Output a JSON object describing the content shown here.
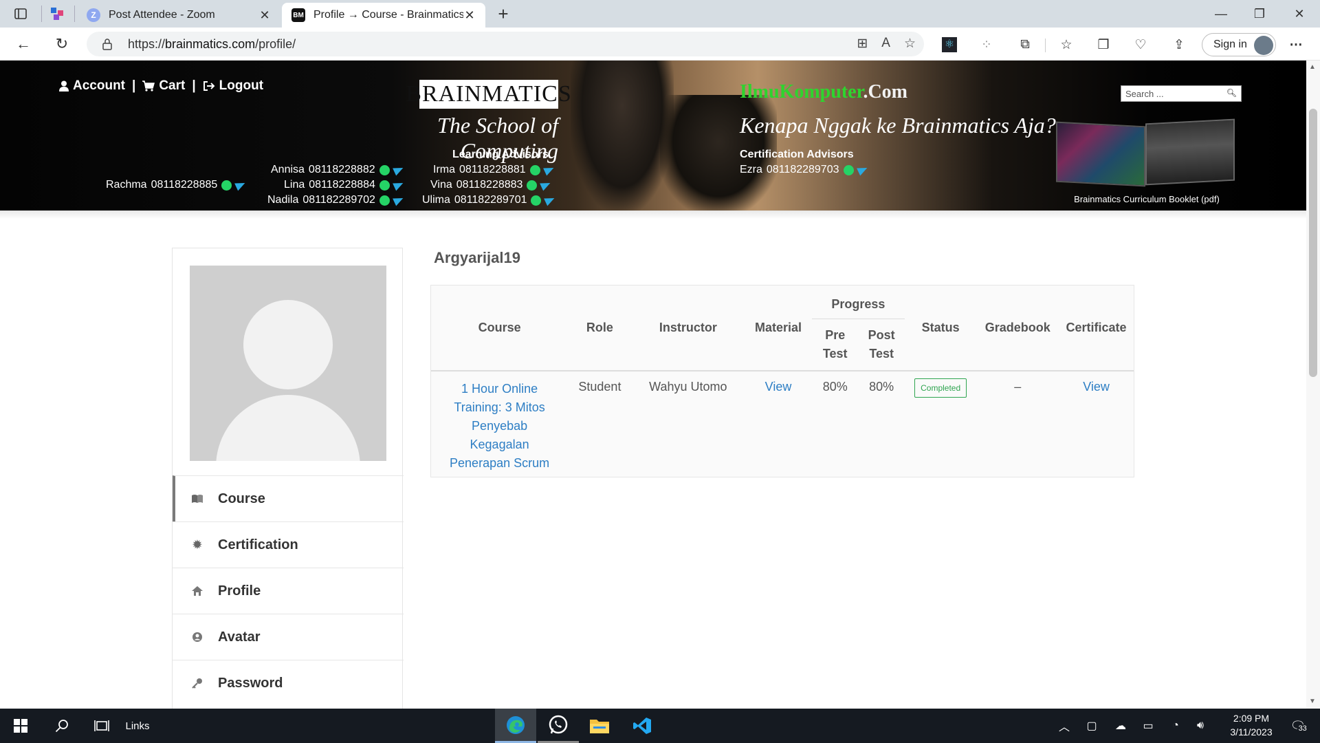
{
  "browser": {
    "tabs": [
      {
        "title": "Post Attendee - Zoom",
        "favicon": "Z",
        "active": false
      },
      {
        "title": "Profile → Course - Brainmatics",
        "favicon": "BM",
        "active": true
      }
    ],
    "url_scheme": "https://",
    "url_host": "brainmatics.com",
    "url_path": "/profile/",
    "signin_label": "Sign in"
  },
  "banner": {
    "account_label": "Account",
    "cart_label": "Cart",
    "logout_label": "Logout",
    "separator": "|",
    "logo_text": "BRAINMATICS",
    "tagline": "The School of Computing",
    "learning_title": "Learning Advisors",
    "learning_advisors": [
      {
        "name": "Rachma",
        "phone": "08118228885"
      },
      {
        "name": "Annisa",
        "phone": "08118228882"
      },
      {
        "name": "Lina",
        "phone": "08118228884"
      },
      {
        "name": "Nadila",
        "phone": "081182289702"
      },
      {
        "name": "Irma",
        "phone": "08118228881"
      },
      {
        "name": "Vina",
        "phone": "08118228883"
      },
      {
        "name": "Ulima",
        "phone": "081182289701"
      }
    ],
    "ilmu_green": "IlmuKomputer",
    "ilmu_white": ".Com",
    "kenapa": "Kenapa Nggak ke Brainmatics Aja?",
    "cert_title": "Certification Advisors",
    "cert_advisors": [
      {
        "name": "Ezra",
        "phone": "081182289703"
      }
    ],
    "search_placeholder": "Search ...",
    "booklet_caption": "Brainmatics Curriculum Booklet (pdf)"
  },
  "sidebar": {
    "items": [
      {
        "label": "Course",
        "icon": "book-icon",
        "active": true
      },
      {
        "label": "Certification",
        "icon": "certificate-icon",
        "active": false
      },
      {
        "label": "Profile",
        "icon": "home-icon",
        "active": false
      },
      {
        "label": "Avatar",
        "icon": "user-circle-icon",
        "active": false
      },
      {
        "label": "Password",
        "icon": "key-icon",
        "active": false
      }
    ]
  },
  "main": {
    "username": "Argyarijal19",
    "table": {
      "headers": {
        "course": "Course",
        "role": "Role",
        "instructor": "Instructor",
        "material": "Material",
        "progress": "Progress",
        "pre_test": "Pre Test",
        "post_test": "Post Test",
        "status": "Status",
        "gradebook": "Gradebook",
        "certificate": "Certificate"
      },
      "rows": [
        {
          "course": "1 Hour Online Training: 3 Mitos Penyebab Kegagalan Penerapan Scrum",
          "role": "Student",
          "instructor": "Wahyu Utomo",
          "material": "View",
          "pre_test": "80%",
          "post_test": "80%",
          "status": "Completed",
          "gradebook": "–",
          "certificate": "View"
        }
      ]
    }
  },
  "taskbar": {
    "links_label": "Links",
    "time": "2:09 PM",
    "date": "3/11/2023",
    "notifications": "33"
  },
  "colors": {
    "link": "#2d7ec4",
    "status_green": "#2ea44f",
    "ilmu_green": "#2ed42e"
  }
}
